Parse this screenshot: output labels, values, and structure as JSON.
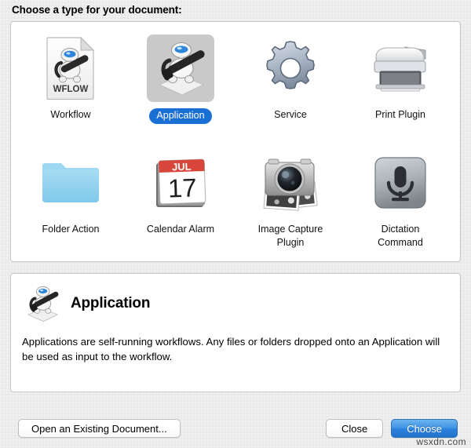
{
  "header": {
    "title": "Choose a type for your document:"
  },
  "document_types": [
    {
      "id": "workflow",
      "label": "Workflow",
      "icon": "workflow-document-icon",
      "selected": false
    },
    {
      "id": "application",
      "label": "Application",
      "icon": "application-robot-icon",
      "selected": true
    },
    {
      "id": "service",
      "label": "Service",
      "icon": "gear-icon",
      "selected": false
    },
    {
      "id": "print-plugin",
      "label": "Print Plugin",
      "icon": "printer-icon",
      "selected": false
    },
    {
      "id": "folder-action",
      "label": "Folder Action",
      "icon": "folder-icon",
      "selected": false
    },
    {
      "id": "calendar-alarm",
      "label": "Calendar Alarm",
      "icon": "calendar-icon",
      "selected": false
    },
    {
      "id": "image-capture",
      "label": "Image Capture\nPlugin",
      "icon": "camera-icon",
      "selected": false
    },
    {
      "id": "dictation",
      "label": "Dictation\nCommand",
      "icon": "microphone-icon",
      "selected": false
    }
  ],
  "description": {
    "icon": "application-robot-icon",
    "title": "Application",
    "body": "Applications are self-running workflows. Any files or folders dropped onto an Application will be used as input to the workflow."
  },
  "footer": {
    "open_existing_label": "Open an Existing Document...",
    "close_label": "Close",
    "choose_label": "Choose"
  },
  "calendar_icon": {
    "month": "JUL",
    "day": "17"
  },
  "workflow_icon": {
    "extension_text": "WFLOW"
  },
  "watermark": "wsxdn.com",
  "colors": {
    "selection_blue": "#1a6fd4",
    "default_button_blue": "#2b82de",
    "selection_tile_gray": "#c9c9c9",
    "calendar_red": "#d8453a",
    "folder_blue": "#8ed3f0",
    "window_background": "#ececec"
  }
}
